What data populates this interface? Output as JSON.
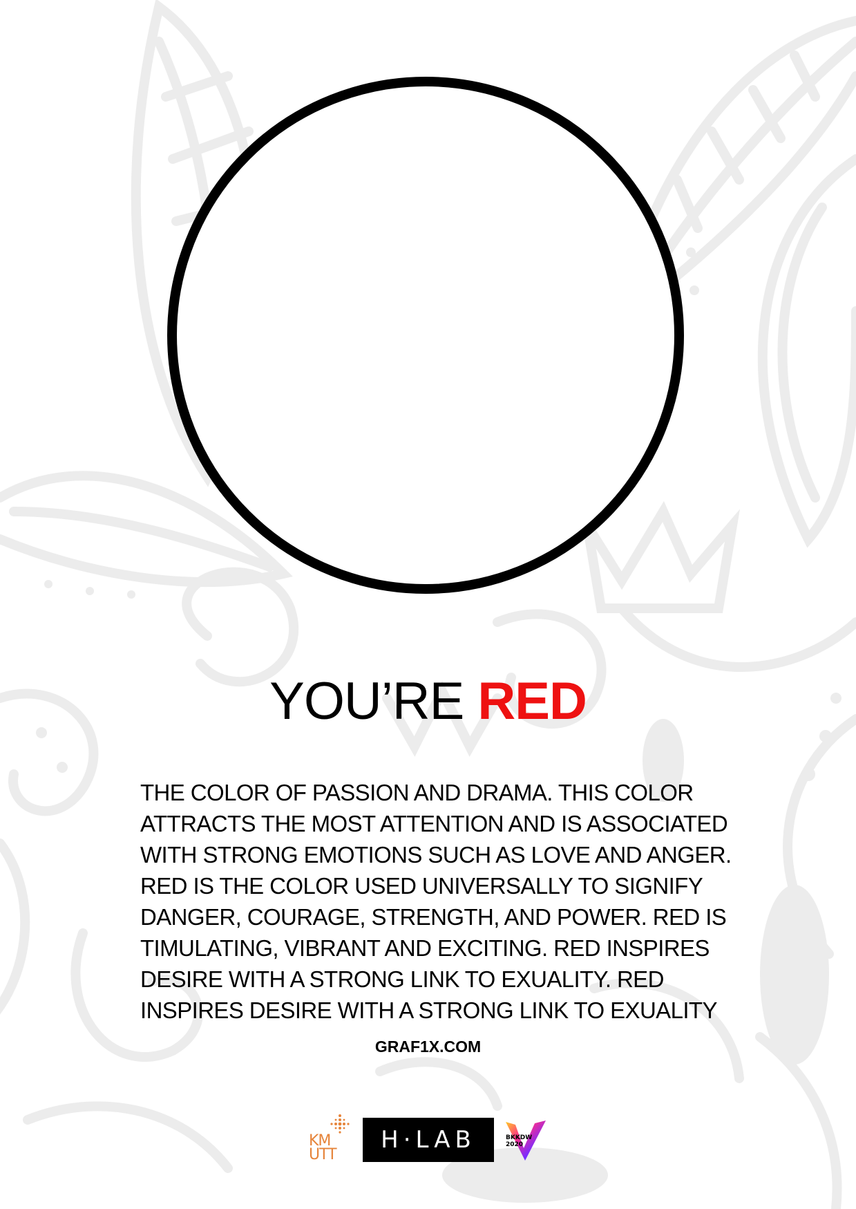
{
  "headline": {
    "prefix": "YOU’RE",
    "accent": "RED",
    "accent_color": "#ee1111"
  },
  "description": {
    "lines": [
      "THE COLOR OF PASSION AND DRAMA. THIS COLOR",
      "ATTRACTS THE MOST ATTENTION AND IS ASSOCIATED",
      "WITH STRONG EMOTIONS SUCH AS LOVE AND ANGER.",
      "RED IS THE COLOR USED UNIVERSALLY TO SIGNIFY",
      "DANGER, COURAGE, STRENGTH, AND POWER. RED IS",
      "TIMULATING, VIBRANT AND EXCITING. RED INSPIRES",
      "DESIRE WITH A STRONG LINK TO EXUALITY. RED",
      "INSPIRES DESIRE WITH A STRONG LINK TO EXUALITY"
    ]
  },
  "website": "GRAF1X.COM",
  "logos": {
    "kmutt_text": "KM UTT",
    "hlab_text": "H·LAB",
    "bkkdw_text": "BKKDW 2020"
  },
  "background": {
    "ornament_color": "#ececec"
  }
}
